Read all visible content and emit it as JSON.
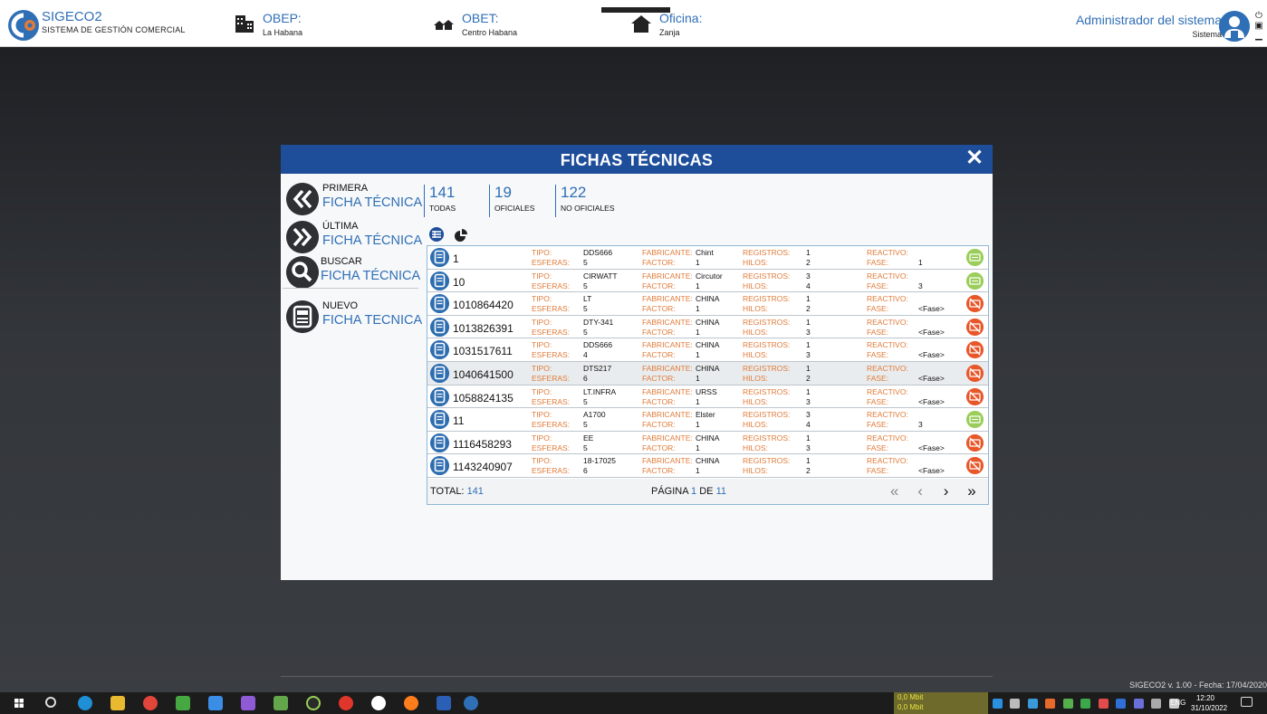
{
  "header": {
    "app_title": "SIGECO2",
    "app_subtitle": "SISTEMA DE GESTIÓN COMERCIAL",
    "obep_title": "OBEP:",
    "obep_value": "La Habana",
    "obet_title": "OBET:",
    "obet_value": "Centro Habana",
    "oficina_title": "Oficina:",
    "oficina_value": "Zanja",
    "user_name": "Administrador del sistema",
    "user_role": "Sistema"
  },
  "modal": {
    "title": "FICHAS TÉCNICAS",
    "close_icon": "✕"
  },
  "actions": [
    {
      "small": "PRIMERA",
      "big": "FICHA TÉCNICA",
      "icon": "double-chevron-left-icon"
    },
    {
      "small": "ÚLTIMA",
      "big": "FICHA TÉCNICA",
      "icon": "double-chevron-right-icon"
    },
    {
      "small": "BUSCAR",
      "big": "FICHA TÉCNICA",
      "icon": "search-icon"
    },
    {
      "small": "NUEVO",
      "big": "FICHA TECNICA",
      "icon": "meter-icon"
    }
  ],
  "counters": [
    {
      "num": "141",
      "label": "TODAS"
    },
    {
      "num": "19",
      "label": "OFICIALES"
    },
    {
      "num": "122",
      "label": "NO OFICIALES"
    }
  ],
  "labels": {
    "tipo": "TIPO:",
    "esferas": "ESFERAS:",
    "fabricante": "FABRICANTE:",
    "factor": "FACTOR:",
    "registros": "REGISTROS:",
    "hilos": "HILOS:",
    "reactivo": "REACTIVO:",
    "fase": "FASE:"
  },
  "rows": [
    {
      "id": "1",
      "tipo": "DDS666",
      "esferas": "5",
      "fabricante": "Chint",
      "factor": "1",
      "registros": "1",
      "hilos": "2",
      "reactivo": "",
      "fase": "1",
      "status": "ok"
    },
    {
      "id": "10",
      "tipo": "CIRWATT",
      "esferas": "5",
      "fabricante": "Circutor",
      "factor": "1",
      "registros": "3",
      "hilos": "4",
      "reactivo": "",
      "fase": "3",
      "status": "ok"
    },
    {
      "id": "1010864420",
      "tipo": "LT",
      "esferas": "5",
      "fabricante": "CHINA",
      "factor": "1",
      "registros": "1",
      "hilos": "2",
      "reactivo": "",
      "fase": "<Fase>",
      "status": "no"
    },
    {
      "id": "1013826391",
      "tipo": "DTY-341",
      "esferas": "5",
      "fabricante": "CHINA",
      "factor": "1",
      "registros": "1",
      "hilos": "3",
      "reactivo": "",
      "fase": "<Fase>",
      "status": "no"
    },
    {
      "id": "1031517611",
      "tipo": "DDS666",
      "esferas": "4",
      "fabricante": "CHINA",
      "factor": "1",
      "registros": "1",
      "hilos": "3",
      "reactivo": "",
      "fase": "<Fase>",
      "status": "no"
    },
    {
      "id": "1040641500",
      "tipo": "DTS217",
      "esferas": "6",
      "fabricante": "CHINA",
      "factor": "1",
      "registros": "1",
      "hilos": "2",
      "reactivo": "",
      "fase": "<Fase>",
      "status": "no"
    },
    {
      "id": "1058824135",
      "tipo": "LT.INFRA",
      "esferas": "5",
      "fabricante": "URSS",
      "factor": "1",
      "registros": "1",
      "hilos": "3",
      "reactivo": "",
      "fase": "<Fase>",
      "status": "no"
    },
    {
      "id": "11",
      "tipo": "A1700",
      "esferas": "5",
      "fabricante": "Elster",
      "factor": "1",
      "registros": "3",
      "hilos": "4",
      "reactivo": "",
      "fase": "3",
      "status": "ok"
    },
    {
      "id": "1116458293",
      "tipo": "EE",
      "esferas": "5",
      "fabricante": "CHINA",
      "factor": "1",
      "registros": "1",
      "hilos": "3",
      "reactivo": "",
      "fase": "<Fase>",
      "status": "no"
    },
    {
      "id": "1143240907",
      "tipo": "18-17025",
      "esferas": "6",
      "fabricante": "CHINA",
      "factor": "1",
      "registros": "1",
      "hilos": "2",
      "reactivo": "",
      "fase": "<Fase>",
      "status": "no"
    }
  ],
  "footer": {
    "total_label": "TOTAL:",
    "total_value": "141",
    "page_label": "PÁGINA",
    "page_current": "1",
    "page_of": "DE",
    "page_total": "11",
    "first": "«",
    "prev": "‹",
    "next": "›",
    "last": "»"
  },
  "version_text": "SIGECO2 v. 1.00 - Fecha: 17/04/2020",
  "taskbar": {
    "net_up": "0,0 Mbit",
    "net_down": "0,0 Mbit",
    "lang": "ENG",
    "time": "12:20",
    "date": "31/10/2022"
  },
  "colors": {
    "brand_blue": "#2f6fb6",
    "header_blue": "#1e4e9a",
    "orange_label": "#e07b39",
    "status_ok": "#9acd5a",
    "status_no": "#e8572a"
  }
}
